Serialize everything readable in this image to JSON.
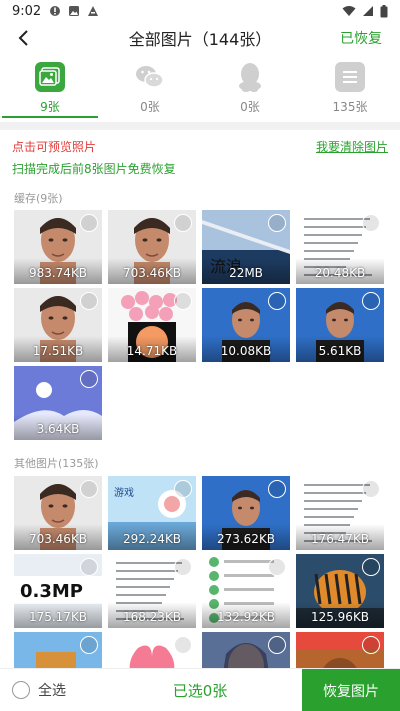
{
  "status_bar": {
    "time": "9:02",
    "icons": [
      "alert-icon",
      "photo-icon",
      "text-a-icon"
    ],
    "right_icons": [
      "wifi-icon",
      "signal-icon",
      "battery-icon"
    ]
  },
  "header": {
    "title": "全部图片（144张）",
    "restored_label": "已恢复"
  },
  "tabs": [
    {
      "name": "photos",
      "icon": "gallery-icon",
      "count": "9张",
      "active": true,
      "color": "#3aa73f"
    },
    {
      "name": "wechat",
      "icon": "wechat-icon",
      "count": "0张",
      "active": false,
      "color": "#cfcfcf"
    },
    {
      "name": "qq",
      "icon": "qq-icon",
      "count": "0张",
      "active": false,
      "color": "#cfcfcf"
    },
    {
      "name": "files",
      "icon": "file-icon",
      "count": "135张",
      "active": false,
      "color": "#cfcfcf"
    }
  ],
  "notice": {
    "preview": "点击可预览照片",
    "free_restore": "扫描完成后前8张图片免费恢复",
    "clear_link": "我要清除图片"
  },
  "sections": [
    {
      "label": "缓存(9张)",
      "items": [
        {
          "size": "983.74KB",
          "thumb": "portrait"
        },
        {
          "size": "703.46KB",
          "thumb": "portrait"
        },
        {
          "size": "22MB",
          "thumb": "space"
        },
        {
          "size": "20.48KB",
          "thumb": "document"
        },
        {
          "size": "17.51KB",
          "thumb": "portrait"
        },
        {
          "size": "14.71KB",
          "thumb": "balloons"
        },
        {
          "size": "10.08KB",
          "thumb": "portrait-blue"
        },
        {
          "size": "5.61KB",
          "thumb": "portrait-blue"
        },
        {
          "size": "3.64KB",
          "thumb": "placeholder"
        }
      ]
    },
    {
      "label": "其他图片(135张)",
      "items": [
        {
          "size": "703.46KB",
          "thumb": "portrait"
        },
        {
          "size": "292.24KB",
          "thumb": "game-banner"
        },
        {
          "size": "273.62KB",
          "thumb": "portrait-blue"
        },
        {
          "size": "176.47KB",
          "thumb": "document"
        },
        {
          "size": "175.17KB",
          "thumb": "camera-ad"
        },
        {
          "size": "168.23KB",
          "thumb": "document"
        },
        {
          "size": "132.92KB",
          "thumb": "app-list"
        },
        {
          "size": "125.96KB",
          "thumb": "tiger"
        },
        {
          "size": "",
          "thumb": "game-scene"
        },
        {
          "size": "",
          "thumb": "pink-shape"
        },
        {
          "size": "",
          "thumb": "fantasy"
        },
        {
          "size": "",
          "thumb": "poster"
        }
      ]
    }
  ],
  "bottom": {
    "select_all": "全选",
    "selected": "已选0张",
    "recover": "恢复图片"
  },
  "colors": {
    "accent": "#2aa12f",
    "warning": "#e43a3a"
  }
}
